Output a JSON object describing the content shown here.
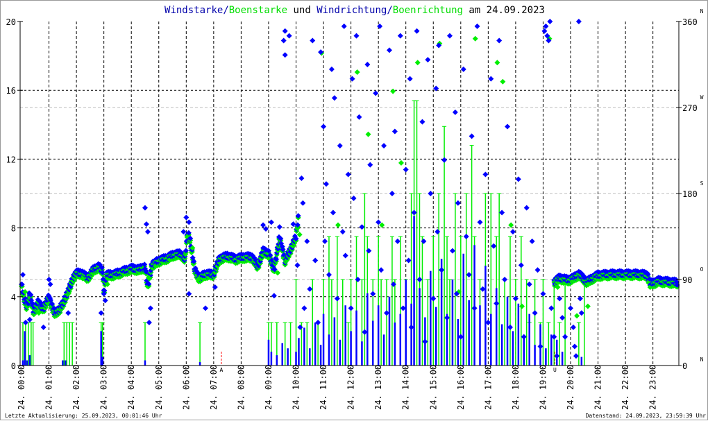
{
  "chart_data": {
    "type": "scatter",
    "title_parts": [
      {
        "text": "Windstarke",
        "color": "#0000aa"
      },
      {
        "text": "/",
        "color": "#0000aa"
      },
      {
        "text": "Boenstarke",
        "color": "#00dd00"
      },
      {
        "text": " und ",
        "color": "#000000"
      },
      {
        "text": "Windrichtung",
        "color": "#0000aa"
      },
      {
        "text": "/",
        "color": "#0000aa"
      },
      {
        "text": "Boenrichtung",
        "color": "#00dd00"
      },
      {
        "text": " am 24.09.2023",
        "color": "#000000"
      }
    ],
    "colors": {
      "wind": "#0000ff",
      "gust": "#00ee00",
      "marker": "#ff0000"
    },
    "x_range_hours": [
      0,
      24
    ],
    "x_tick_labels": [
      "24. 00:00",
      "24. 01:00",
      "24. 02:00",
      "24. 03:00",
      "24. 04:00",
      "24. 05:00",
      "24. 06:00",
      "24. 07:00",
      "24. 08:00",
      "24. 09:00",
      "24. 10:00",
      "24. 11:00",
      "24. 12:00",
      "24. 13:00",
      "24. 14:00",
      "24. 15:00",
      "24. 16:00",
      "24. 17:00",
      "24. 18:00",
      "24. 19:00",
      "24. 20:00",
      "24. 21:00",
      "24. 22:00",
      "24. 23:00"
    ],
    "y_left": {
      "label": "Windstarke",
      "range": [
        0,
        20
      ],
      "ticks": [
        "0",
        "4",
        "8",
        "12",
        "16",
        "20"
      ]
    },
    "y_right": {
      "label": "Windrichtung",
      "range": [
        0,
        360
      ],
      "ticks": [
        "0",
        "90",
        "180",
        "270",
        "360"
      ],
      "compass": [
        {
          "deg": 0,
          "label": "N"
        },
        {
          "deg": 90,
          "label": "O"
        },
        {
          "deg": 180,
          "label": "S"
        },
        {
          "deg": 270,
          "label": "W"
        },
        {
          "deg": 360,
          "label": "N"
        }
      ]
    },
    "grid": true,
    "sun_markers": [
      {
        "label": "A",
        "hour": 7.28
      },
      {
        "label": "U",
        "hour": 19.43
      }
    ],
    "direction_trend": [
      [
        0.0,
        85
      ],
      [
        0.1,
        70
      ],
      [
        0.2,
        62
      ],
      [
        0.3,
        76
      ],
      [
        0.45,
        56
      ],
      [
        0.6,
        66
      ],
      [
        0.8,
        60
      ],
      [
        1.0,
        72
      ],
      [
        1.2,
        55
      ],
      [
        1.4,
        60
      ],
      [
        1.55,
        68
      ],
      [
        1.7,
        78
      ],
      [
        1.85,
        90
      ],
      [
        2.0,
        97
      ],
      [
        2.2,
        97
      ],
      [
        2.4,
        92
      ],
      [
        2.6,
        100
      ],
      [
        2.8,
        104
      ],
      [
        2.95,
        100
      ],
      [
        3.0,
        78
      ],
      [
        3.1,
        95
      ],
      [
        3.4,
        96
      ],
      [
        3.7,
        99
      ],
      [
        4.0,
        102
      ],
      [
        4.3,
        101
      ],
      [
        4.5,
        104
      ],
      [
        4.6,
        82
      ],
      [
        4.75,
        106
      ],
      [
        5.0,
        110
      ],
      [
        5.3,
        113
      ],
      [
        5.6,
        117
      ],
      [
        5.8,
        117
      ],
      [
        5.95,
        112
      ],
      [
        6.05,
        140
      ],
      [
        6.15,
        130
      ],
      [
        6.3,
        102
      ],
      [
        6.45,
        92
      ],
      [
        6.7,
        96
      ],
      [
        7.0,
        96
      ],
      [
        7.2,
        112
      ],
      [
        7.5,
        115
      ],
      [
        7.8,
        112
      ],
      [
        8.1,
        114
      ],
      [
        8.4,
        114
      ],
      [
        8.6,
        104
      ],
      [
        8.8,
        120
      ],
      [
        9.0,
        118
      ],
      [
        9.2,
        100
      ],
      [
        9.4,
        135
      ],
      [
        9.6,
        110
      ],
      [
        9.8,
        122
      ],
      [
        10.0,
        135
      ],
      [
        10.1,
        160
      ]
    ],
    "direction_trend_late": [
      [
        19.4,
        88
      ],
      [
        19.6,
        92
      ],
      [
        19.9,
        90
      ],
      [
        20.1,
        92
      ],
      [
        20.3,
        96
      ],
      [
        20.6,
        88
      ],
      [
        20.8,
        92
      ],
      [
        21.0,
        95
      ],
      [
        21.5,
        96
      ],
      [
        22.0,
        96
      ],
      [
        22.5,
        96
      ],
      [
        22.8,
        95
      ],
      [
        22.9,
        86
      ],
      [
        23.2,
        89
      ],
      [
        23.6,
        88
      ],
      [
        23.9,
        87
      ]
    ],
    "direction_scatter": [
      [
        0.05,
        95
      ],
      [
        0.15,
        45
      ],
      [
        0.3,
        48
      ],
      [
        0.8,
        40
      ],
      [
        1.0,
        90
      ],
      [
        1.05,
        85
      ],
      [
        1.7,
        55
      ],
      [
        2.9,
        55
      ],
      [
        3.0,
        75
      ],
      [
        3.05,
        68
      ],
      [
        4.5,
        165
      ],
      [
        4.55,
        148
      ],
      [
        4.6,
        140
      ],
      [
        4.65,
        45
      ],
      [
        4.7,
        60
      ],
      [
        5.9,
        140
      ],
      [
        6.0,
        155
      ],
      [
        6.1,
        150
      ],
      [
        6.1,
        75
      ],
      [
        6.7,
        60
      ],
      [
        7.05,
        82
      ],
      [
        8.8,
        147
      ],
      [
        8.9,
        143
      ],
      [
        9.1,
        150
      ],
      [
        9.2,
        73
      ],
      [
        9.4,
        145
      ],
      [
        9.55,
        340
      ],
      [
        9.6,
        350
      ],
      [
        9.6,
        325
      ],
      [
        9.75,
        345
      ],
      [
        9.9,
        148
      ],
      [
        10.05,
        105
      ],
      [
        10.15,
        40
      ],
      [
        10.2,
        196
      ],
      [
        10.25,
        170
      ],
      [
        10.3,
        60
      ],
      [
        10.4,
        130
      ],
      [
        10.5,
        80
      ],
      [
        10.6,
        340
      ],
      [
        10.7,
        110
      ],
      [
        10.8,
        45
      ],
      [
        10.9,
        328
      ],
      [
        11.0,
        250
      ],
      [
        11.05,
        130
      ],
      [
        11.1,
        190
      ],
      [
        11.2,
        95
      ],
      [
        11.3,
        310
      ],
      [
        11.35,
        160
      ],
      [
        11.4,
        280
      ],
      [
        11.5,
        70
      ],
      [
        11.6,
        230
      ],
      [
        11.7,
        140
      ],
      [
        11.75,
        355
      ],
      [
        11.8,
        115
      ],
      [
        11.9,
        200
      ],
      [
        12.0,
        60
      ],
      [
        12.05,
        300
      ],
      [
        12.1,
        175
      ],
      [
        12.2,
        345
      ],
      [
        12.25,
        90
      ],
      [
        12.3,
        260
      ],
      [
        12.4,
        145
      ],
      [
        12.5,
        35
      ],
      [
        12.6,
        315
      ],
      [
        12.65,
        120
      ],
      [
        12.7,
        210
      ],
      [
        12.8,
        75
      ],
      [
        12.9,
        285
      ],
      [
        13.0,
        150
      ],
      [
        13.05,
        355
      ],
      [
        13.1,
        100
      ],
      [
        13.2,
        230
      ],
      [
        13.3,
        55
      ],
      [
        13.4,
        330
      ],
      [
        13.5,
        180
      ],
      [
        13.55,
        85
      ],
      [
        13.6,
        245
      ],
      [
        13.7,
        130
      ],
      [
        13.8,
        345
      ],
      [
        13.9,
        60
      ],
      [
        14.0,
        205
      ],
      [
        14.1,
        110
      ],
      [
        14.15,
        300
      ],
      [
        14.2,
        40
      ],
      [
        14.3,
        160
      ],
      [
        14.4,
        350
      ],
      [
        14.5,
        90
      ],
      [
        14.6,
        255
      ],
      [
        14.65,
        130
      ],
      [
        14.7,
        25
      ],
      [
        14.8,
        320
      ],
      [
        14.9,
        180
      ],
      [
        15.0,
        70
      ],
      [
        15.1,
        290
      ],
      [
        15.15,
        140
      ],
      [
        15.2,
        335
      ],
      [
        15.3,
        100
      ],
      [
        15.4,
        215
      ],
      [
        15.5,
        50
      ],
      [
        15.6,
        345
      ],
      [
        15.7,
        120
      ],
      [
        15.8,
        265
      ],
      [
        15.85,
        75
      ],
      [
        15.9,
        170
      ],
      [
        16.0,
        30
      ],
      [
        16.1,
        310
      ],
      [
        16.2,
        135
      ],
      [
        16.3,
        95
      ],
      [
        16.4,
        240
      ],
      [
        16.5,
        60
      ],
      [
        16.6,
        355
      ],
      [
        16.7,
        150
      ],
      [
        16.8,
        80
      ],
      [
        16.9,
        200
      ],
      [
        17.0,
        45
      ],
      [
        17.1,
        300
      ],
      [
        17.2,
        125
      ],
      [
        17.3,
        65
      ],
      [
        17.4,
        340
      ],
      [
        17.5,
        160
      ],
      [
        17.6,
        90
      ],
      [
        17.7,
        250
      ],
      [
        17.8,
        40
      ],
      [
        17.9,
        140
      ],
      [
        18.0,
        70
      ],
      [
        18.1,
        195
      ],
      [
        18.2,
        105
      ],
      [
        18.3,
        30
      ],
      [
        18.4,
        165
      ],
      [
        18.5,
        85
      ],
      [
        18.6,
        130
      ],
      [
        18.7,
        55
      ],
      [
        18.8,
        100
      ],
      [
        18.9,
        20
      ],
      [
        19.0,
        75
      ],
      [
        19.05,
        350
      ],
      [
        19.1,
        355
      ],
      [
        19.15,
        345
      ],
      [
        19.2,
        340
      ],
      [
        19.25,
        360
      ],
      [
        19.3,
        60
      ],
      [
        19.4,
        30
      ],
      [
        19.5,
        10
      ],
      [
        19.6,
        70
      ],
      [
        19.7,
        50
      ],
      [
        19.8,
        30
      ],
      [
        20.0,
        60
      ],
      [
        20.1,
        40
      ],
      [
        20.15,
        20
      ],
      [
        20.2,
        10
      ],
      [
        20.3,
        360
      ],
      [
        20.35,
        70
      ],
      [
        20.4,
        55
      ]
    ],
    "gust_direction_scatter": [
      [
        0.1,
        80
      ],
      [
        0.6,
        58
      ],
      [
        2.2,
        94
      ],
      [
        3.1,
        88
      ],
      [
        4.6,
        95
      ],
      [
        6.2,
        126
      ],
      [
        6.4,
        93
      ],
      [
        9.3,
        100
      ],
      [
        10.1,
        140
      ],
      [
        10.9,
        330
      ],
      [
        11.5,
        150
      ],
      [
        12.2,
        310
      ],
      [
        12.6,
        245
      ],
      [
        13.1,
        150
      ],
      [
        13.5,
        290
      ],
      [
        13.8,
        215
      ],
      [
        14.4,
        320
      ],
      [
        15.2,
        340
      ],
      [
        15.9,
        80
      ],
      [
        16.5,
        345
      ],
      [
        17.3,
        320
      ],
      [
        17.5,
        300
      ],
      [
        17.8,
        150
      ],
      [
        18.2,
        65
      ],
      [
        19.2,
        345
      ],
      [
        19.5,
        85
      ],
      [
        20.2,
        55
      ],
      [
        20.6,
        65
      ]
    ],
    "gust_speed": [
      [
        0.05,
        2.5
      ],
      [
        0.15,
        2.5
      ],
      [
        0.25,
        2.5
      ],
      [
        0.35,
        2.5
      ],
      [
        0.42,
        2.5
      ],
      [
        1.55,
        2.5
      ],
      [
        1.65,
        2.5
      ],
      [
        1.75,
        2.5
      ],
      [
        1.85,
        2.5
      ],
      [
        2.9,
        2.5
      ],
      [
        2.95,
        2.5
      ],
      [
        4.5,
        2.5
      ],
      [
        6.5,
        2.5
      ],
      [
        9.0,
        2.5
      ],
      [
        9.1,
        2.5
      ],
      [
        9.3,
        2.5
      ],
      [
        9.6,
        2.5
      ],
      [
        9.8,
        2.5
      ],
      [
        10.0,
        5
      ],
      [
        10.2,
        2.5
      ],
      [
        10.4,
        2.5
      ],
      [
        10.6,
        5
      ],
      [
        10.8,
        2.5
      ],
      [
        11.0,
        5
      ],
      [
        11.2,
        7.5
      ],
      [
        11.3,
        5
      ],
      [
        11.5,
        7.5
      ],
      [
        11.7,
        5
      ],
      [
        11.9,
        2.5
      ],
      [
        12.0,
        5
      ],
      [
        12.2,
        7.5
      ],
      [
        12.4,
        5
      ],
      [
        12.5,
        10
      ],
      [
        12.6,
        7.5
      ],
      [
        12.8,
        5
      ],
      [
        13.0,
        7.5
      ],
      [
        13.1,
        5
      ],
      [
        13.3,
        5
      ],
      [
        13.5,
        7.5
      ],
      [
        13.6,
        5
      ],
      [
        13.8,
        7.5
      ],
      [
        14.0,
        5
      ],
      [
        14.2,
        10
      ],
      [
        14.3,
        15.4
      ],
      [
        14.4,
        15.4
      ],
      [
        14.5,
        10
      ],
      [
        14.6,
        7.5
      ],
      [
        14.8,
        5
      ],
      [
        15.0,
        7.5
      ],
      [
        15.2,
        10
      ],
      [
        15.4,
        13.9
      ],
      [
        15.5,
        7.5
      ],
      [
        15.6,
        5
      ],
      [
        15.8,
        10
      ],
      [
        16.0,
        7.5
      ],
      [
        16.2,
        10
      ],
      [
        16.4,
        12.8
      ],
      [
        16.5,
        7.5
      ],
      [
        16.7,
        5
      ],
      [
        16.9,
        10
      ],
      [
        17.1,
        10
      ],
      [
        17.3,
        7.5
      ],
      [
        17.4,
        10
      ],
      [
        17.6,
        5
      ],
      [
        17.8,
        7.5
      ],
      [
        18.0,
        5
      ],
      [
        18.2,
        7.5
      ],
      [
        18.4,
        5
      ],
      [
        18.5,
        2.5
      ],
      [
        18.7,
        5
      ],
      [
        18.9,
        2.5
      ],
      [
        19.0,
        5
      ],
      [
        19.2,
        2.5
      ],
      [
        19.4,
        5
      ],
      [
        19.6,
        2.5
      ],
      [
        19.8,
        5
      ],
      [
        20.3,
        2.5
      ],
      [
        20.5,
        5
      ]
    ],
    "wind_speed": [
      [
        0.05,
        0.3
      ],
      [
        0.12,
        2.0
      ],
      [
        0.2,
        0.3
      ],
      [
        0.3,
        0.6
      ],
      [
        1.5,
        0.3
      ],
      [
        1.6,
        0.3
      ],
      [
        2.9,
        2.0
      ],
      [
        2.95,
        0.5
      ],
      [
        4.5,
        0.3
      ],
      [
        6.5,
        0.2
      ],
      [
        9.0,
        1.5
      ],
      [
        9.1,
        0.8
      ],
      [
        9.3,
        0.6
      ],
      [
        9.5,
        1.3
      ],
      [
        9.7,
        1.0
      ],
      [
        10.0,
        0.8
      ],
      [
        10.1,
        1.6
      ],
      [
        10.3,
        2.2
      ],
      [
        10.5,
        1.0
      ],
      [
        10.7,
        2.5
      ],
      [
        10.9,
        1.2
      ],
      [
        11.0,
        3.0
      ],
      [
        11.2,
        1.8
      ],
      [
        11.4,
        2.8
      ],
      [
        11.6,
        1.5
      ],
      [
        11.8,
        3.5
      ],
      [
        12.0,
        2.0
      ],
      [
        12.2,
        3.2
      ],
      [
        12.4,
        1.4
      ],
      [
        12.6,
        4.2
      ],
      [
        12.8,
        2.6
      ],
      [
        13.0,
        3.5
      ],
      [
        13.2,
        1.8
      ],
      [
        13.4,
        4.0
      ],
      [
        13.6,
        2.5
      ],
      [
        13.8,
        3.0
      ],
      [
        14.0,
        5.0
      ],
      [
        14.2,
        3.6
      ],
      [
        14.3,
        8.7
      ],
      [
        14.5,
        4.5
      ],
      [
        14.7,
        2.8
      ],
      [
        14.9,
        5.5
      ],
      [
        15.1,
        3.4
      ],
      [
        15.3,
        6.2
      ],
      [
        15.5,
        3.0
      ],
      [
        15.7,
        5.0
      ],
      [
        15.9,
        2.7
      ],
      [
        16.1,
        6.5
      ],
      [
        16.3,
        3.8
      ],
      [
        16.5,
        7.0
      ],
      [
        16.7,
        3.5
      ],
      [
        16.9,
        5.8
      ],
      [
        17.1,
        3.0
      ],
      [
        17.3,
        4.5
      ],
      [
        17.5,
        2.4
      ],
      [
        17.7,
        4.0
      ],
      [
        17.9,
        2.0
      ],
      [
        18.1,
        3.6
      ],
      [
        18.3,
        1.6
      ],
      [
        18.5,
        3.0
      ],
      [
        18.7,
        1.2
      ],
      [
        18.9,
        2.4
      ],
      [
        19.1,
        1.0
      ],
      [
        19.3,
        1.8
      ],
      [
        19.5,
        1.5
      ],
      [
        19.7,
        0.8
      ],
      [
        20.4,
        0.5
      ]
    ]
  },
  "footer": {
    "last_update": "Letzte Aktualisierung: 25.09.2023, 00:01:46 Uhr",
    "data_state": "Datenstand: 24.09.2023, 23:59:39 Uhr"
  }
}
